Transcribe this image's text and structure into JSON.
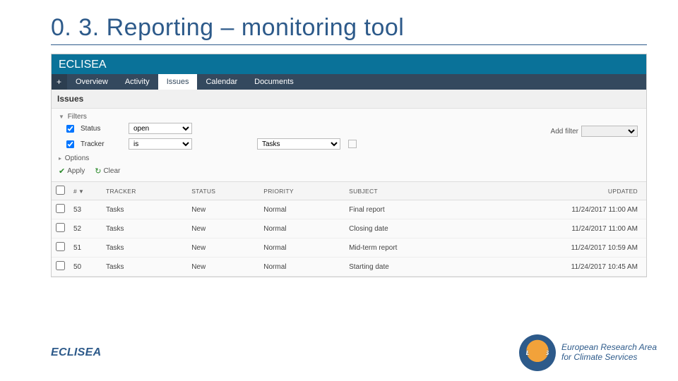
{
  "slide": {
    "title": "0. 3. Reporting – monitoring tool"
  },
  "project": {
    "name": "ECLISEA"
  },
  "tabs": {
    "plus": "+",
    "items": [
      {
        "label": "Overview",
        "active": false
      },
      {
        "label": "Activity",
        "active": false
      },
      {
        "label": "Issues",
        "active": true
      },
      {
        "label": "Calendar",
        "active": false
      },
      {
        "label": "Documents",
        "active": false
      }
    ]
  },
  "pane": {
    "title": "Issues",
    "filters_label": "Filters",
    "options_label": "Options",
    "add_filter_label": "Add filter",
    "filter_rows": [
      {
        "name": "Status",
        "op": "open",
        "val": ""
      },
      {
        "name": "Tracker",
        "op": "is",
        "val": "Tasks"
      }
    ],
    "apply_label": "Apply",
    "clear_label": "Clear"
  },
  "table": {
    "columns": {
      "id": "#",
      "tracker": "Tracker",
      "status": "Status",
      "priority": "Priority",
      "subject": "Subject",
      "updated": "Updated"
    },
    "rows": [
      {
        "id": "53",
        "tracker": "Tasks",
        "status": "New",
        "priority": "Normal",
        "subject": "Final report",
        "updated": "11/24/2017 11:00 AM"
      },
      {
        "id": "52",
        "tracker": "Tasks",
        "status": "New",
        "priority": "Normal",
        "subject": "Closing date",
        "updated": "11/24/2017 11:00 AM"
      },
      {
        "id": "51",
        "tracker": "Tasks",
        "status": "New",
        "priority": "Normal",
        "subject": "Mid-term report",
        "updated": "11/24/2017 10:59 AM"
      },
      {
        "id": "50",
        "tracker": "Tasks",
        "status": "New",
        "priority": "Normal",
        "subject": "Starting date",
        "updated": "11/24/2017 10:45 AM"
      }
    ]
  },
  "footer": {
    "left": "ECLISEA",
    "badge": "ERA4CS",
    "line1": "European Research Area",
    "line2": "for Climate Services"
  }
}
